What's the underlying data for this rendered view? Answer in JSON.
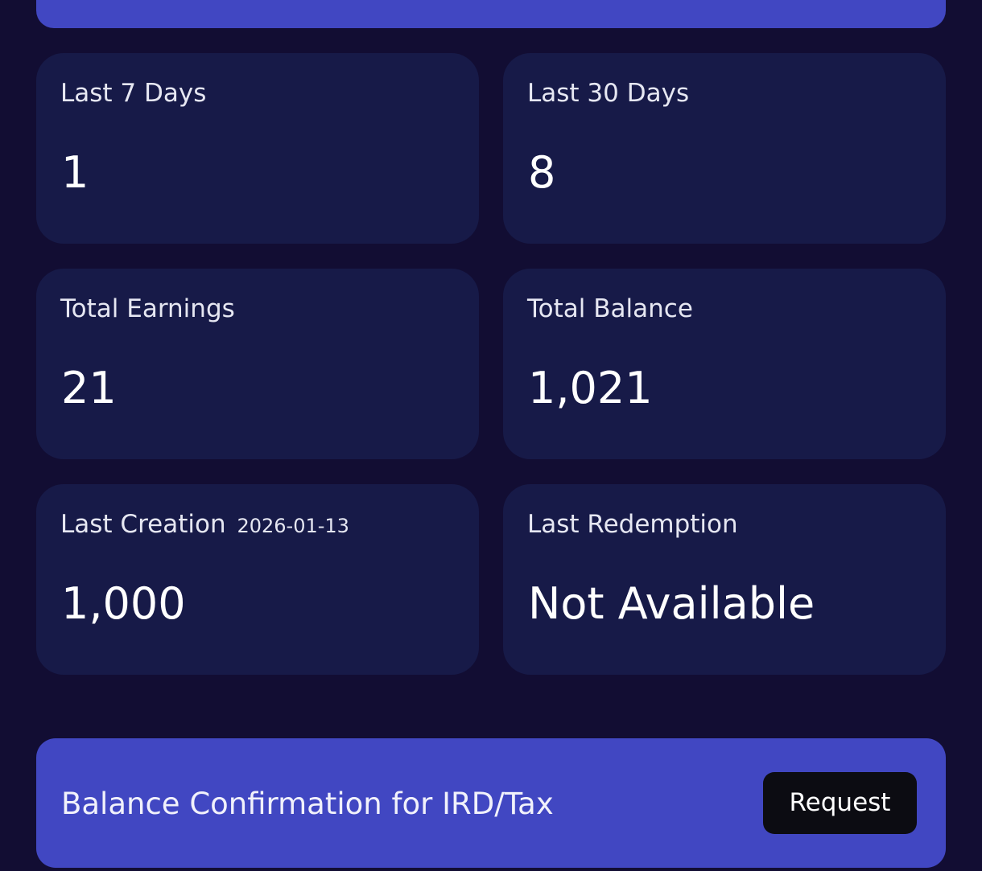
{
  "stats": [
    {
      "label": "Last 7 Days",
      "sub": "",
      "value": "1"
    },
    {
      "label": "Last 30 Days",
      "sub": "",
      "value": "8"
    },
    {
      "label": "Total Earnings",
      "sub": "",
      "value": "21"
    },
    {
      "label": "Total Balance",
      "sub": "",
      "value": "1,021"
    },
    {
      "label": "Last Creation",
      "sub": "2026-01-13",
      "value": "1,000"
    },
    {
      "label": "Last Redemption",
      "sub": "",
      "value": "Not Available"
    }
  ],
  "confirmation": {
    "text": "Balance Confirmation for IRD/Tax",
    "button_label": "Request"
  },
  "colors": {
    "background": "#120d33",
    "card": "#171a48",
    "accent": "#4147c2",
    "button": "#0c0c12"
  }
}
